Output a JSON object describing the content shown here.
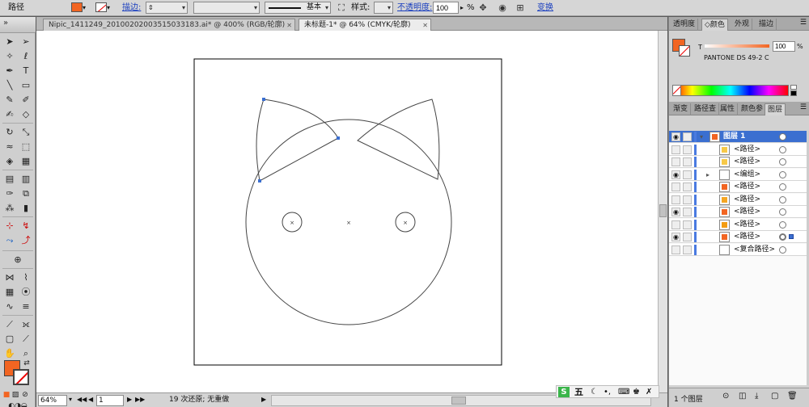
{
  "control_bar": {
    "selection_label": "路径",
    "stroke_label": "描边:",
    "stroke_weight": "",
    "brush_label": "基本",
    "style_label": "样式:",
    "opacity_label": "不透明度:",
    "opacity_value": "100",
    "opacity_unit": "%",
    "transform_label": "变换"
  },
  "colors": {
    "fill": "#f26522",
    "selection": "#3b6fd0",
    "canvas": "#ffffff",
    "artboard_stroke": "#000000"
  },
  "tabs": [
    {
      "label": "Nipic_1411249_20100202003515033183.ai* @ 400% (RGB/轮廓)",
      "active": false
    },
    {
      "label": "未标题-1* @ 64% (CMYK/轮廓)",
      "active": true
    }
  ],
  "status": {
    "zoom": "64%",
    "page": "1",
    "message": "19 次还原; 无重做"
  },
  "color_panel": {
    "tabs": [
      "透明度",
      "颜色",
      "外观",
      "描边"
    ],
    "active_tab": "颜色",
    "t_label": "T",
    "tint_value": "100",
    "tint_unit": "%",
    "swatch_name": "PANTONE DS 49-2 C"
  },
  "layers_panel": {
    "tabs": [
      "渐变",
      "路径查",
      "属性",
      "颜色参",
      "图层"
    ],
    "active_tab": "图层",
    "rows": [
      {
        "name": "图层 1",
        "level": 0,
        "visible": true,
        "selected": true,
        "expanded": true,
        "thumb": "#f26522"
      },
      {
        "name": "<路径>",
        "level": 1,
        "visible": false,
        "selected": false,
        "thumb": "#f7c948"
      },
      {
        "name": "<路径>",
        "level": 1,
        "visible": false,
        "selected": false,
        "thumb": "#f7c948"
      },
      {
        "name": "<编组>",
        "level": 1,
        "visible": true,
        "selected": false,
        "group": true,
        "thumb": "#ffffff"
      },
      {
        "name": "<路径>",
        "level": 1,
        "visible": false,
        "selected": false,
        "thumb": "#f26522"
      },
      {
        "name": "<路径>",
        "level": 1,
        "visible": false,
        "selected": false,
        "thumb": "#f5a623"
      },
      {
        "name": "<路径>",
        "level": 1,
        "visible": true,
        "selected": false,
        "thumb": "#f26522"
      },
      {
        "name": "<路径>",
        "level": 1,
        "visible": false,
        "selected": false,
        "thumb": "#f39c12"
      },
      {
        "name": "<路径>",
        "level": 1,
        "visible": true,
        "selected": false,
        "thumb": "#f26522",
        "selected_item": true
      },
      {
        "name": "<复合路径>",
        "level": 1,
        "visible": false,
        "selected": false,
        "thumb": "#ffffff"
      }
    ],
    "footer_label": "1 个图层"
  },
  "taskbar_ime": {
    "label": "五"
  }
}
